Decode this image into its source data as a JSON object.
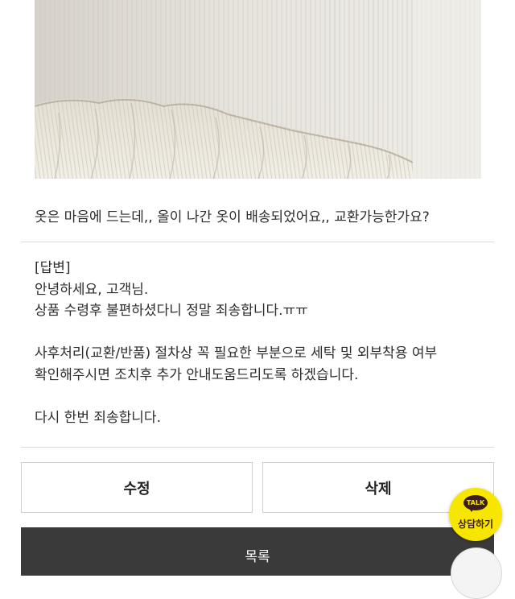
{
  "post": {
    "question": "옷은 마음에 드는데,, 올이 나간 옷이 배송되었어요,, 교환가능한가요?"
  },
  "answer": {
    "lines": [
      "[답변]",
      "안녕하세요, 고객님.",
      "상품 수령후 불편하셨다니 정말 죄송합니다.ㅠㅠ",
      "",
      "사후처리(교환/반품) 절차상 꼭 필요한 부분으로 세탁 및 외부착용 여부",
      "확인해주시면 조치후 추가 안내도움드리도록 하겠습니다.",
      "",
      "다시 한번 죄송합니다."
    ]
  },
  "buttons": {
    "edit": "수정",
    "delete": "삭제",
    "list": "목록"
  },
  "kakao": {
    "badge": "TALK",
    "label": "상담하기"
  },
  "colors": {
    "list_button_bg": "#3a3a3a",
    "kakao_yellow": "#f7e600",
    "divider": "#d9d9d9"
  },
  "icons": {
    "kakao": "kakao-talk-icon",
    "scroll_top": "scroll-top-icon"
  }
}
